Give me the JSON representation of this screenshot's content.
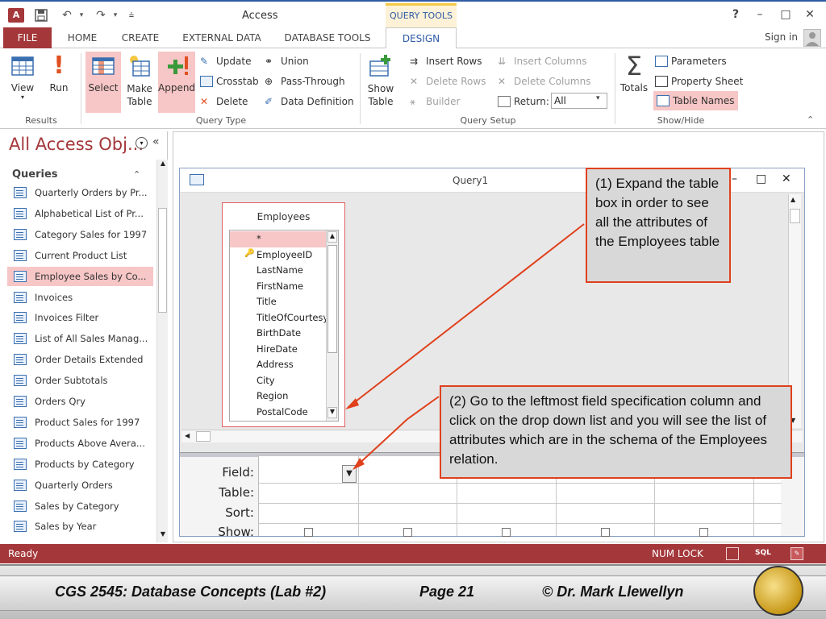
{
  "titlebar": {
    "title": "Access",
    "context_tab": "QUERY TOOLS",
    "logo_text": "A",
    "icons": [
      "save-icon",
      "undo-icon",
      "redo-icon",
      "customize-icon"
    ],
    "help": "?",
    "minimize": "–",
    "maximize": "□",
    "close": "✕"
  },
  "tabs": {
    "file": "FILE",
    "home": "HOME",
    "create": "CREATE",
    "external_data": "EXTERNAL DATA",
    "database_tools": "DATABASE TOOLS",
    "design": "DESIGN",
    "sign_in": "Sign in"
  },
  "ribbon": {
    "results": {
      "label": "Results",
      "view": "View",
      "run": "Run"
    },
    "query_type": {
      "label": "Query Type",
      "select": "Select",
      "make_table_1": "Make",
      "make_table_2": "Table",
      "append": "Append",
      "update": "Update",
      "crosstab": "Crosstab",
      "delete": "Delete",
      "union": "Union",
      "pass_through": "Pass-Through",
      "data_definition": "Data Definition"
    },
    "query_setup": {
      "label": "Query Setup",
      "show_table_1": "Show",
      "show_table_2": "Table",
      "insert_rows": "Insert Rows",
      "delete_rows": "Delete Rows",
      "builder": "Builder",
      "insert_columns": "Insert Columns",
      "delete_columns": "Delete Columns",
      "return_label": "Return:",
      "return_value": "All"
    },
    "show_hide": {
      "label": "Show/Hide",
      "totals": "Totals",
      "parameters": "Parameters",
      "property_sheet": "Property Sheet",
      "table_names": "Table Names"
    }
  },
  "nav": {
    "title": "All Access Obj...",
    "section": "Queries",
    "items": [
      "Quarterly Orders by Pr...",
      "Alphabetical List of Pr...",
      "Category Sales for 1997",
      "Current Product List",
      "Employee Sales by Co...",
      "Invoices",
      "Invoices Filter",
      "List of All Sales Manag...",
      "Order Details Extended",
      "Order Subtotals",
      "Orders Qry",
      "Product Sales for 1997",
      "Products Above Avera...",
      "Products by Category",
      "Quarterly Orders",
      "Sales by Category",
      "Sales by Year"
    ],
    "selected_index": 4
  },
  "query_window": {
    "title": "Query1",
    "table": {
      "name": "Employees",
      "fields": [
        "*",
        "EmployeeID",
        "LastName",
        "FirstName",
        "Title",
        "TitleOfCourtesy",
        "BirthDate",
        "HireDate",
        "Address",
        "City",
        "Region",
        "PostalCode"
      ]
    },
    "grid_labels": {
      "field": "Field:",
      "table": "Table:",
      "sort": "Sort:",
      "show": "Show:"
    }
  },
  "callouts": {
    "one": "(1)  Expand the table box in order to see all the attributes of the Employees table",
    "two": "(2)  Go to the leftmost field specification column and click on the drop down list and you will see the list of attributes which are in the schema of the Employees relation."
  },
  "status": {
    "text": "Ready",
    "num_lock": "NUM LOCK",
    "sql": "SQL"
  },
  "footer": {
    "course": "CGS 2545: Database Concepts  (Lab #2)",
    "page": "Page 21",
    "author": "© Dr. Mark Llewellyn"
  },
  "colors": {
    "access_red": "#a4373a",
    "highlight": "#f7c6c6",
    "callout_border": "#e0401c",
    "accent_blue": "#2e5aa6"
  }
}
